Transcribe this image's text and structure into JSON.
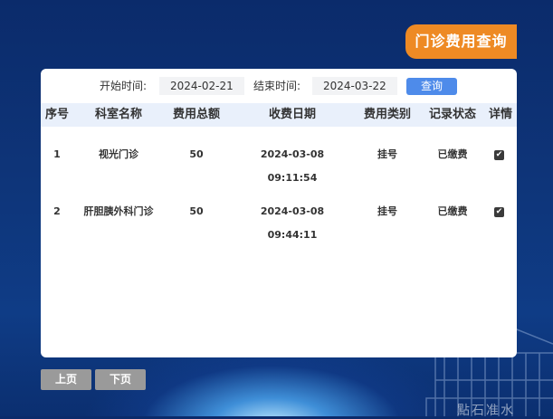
{
  "header": {
    "title": "门诊费用查询"
  },
  "filter": {
    "start_label": "开始时间:",
    "start_value": "2024-02-21",
    "end_label": "结束时间:",
    "end_value": "2024-03-22",
    "query_label": "查询"
  },
  "table": {
    "columns": [
      "序号",
      "科室名称",
      "费用总额",
      "收费日期",
      "费用类别",
      "记录状态",
      "详情"
    ],
    "rows": [
      {
        "index": "1",
        "dept": "视光门诊",
        "amount": "50",
        "date": "2024-03-08 09:11:54",
        "category": "挂号",
        "status": "已缴费",
        "detail_checked": true
      },
      {
        "index": "2",
        "dept": "肝胆胰外科门诊",
        "amount": "50",
        "date": "2024-03-08 09:44:11",
        "category": "挂号",
        "status": "已缴费",
        "detail_checked": true
      }
    ]
  },
  "pager": {
    "prev_label": "上页",
    "next_label": "下页"
  },
  "background": {
    "watermark_text": "點石准水"
  },
  "colors": {
    "title_bg": "#ee8a24",
    "query_button": "#4e8bea",
    "header_row": "#e9f0fb",
    "pager_button": "#9a9a9a"
  }
}
